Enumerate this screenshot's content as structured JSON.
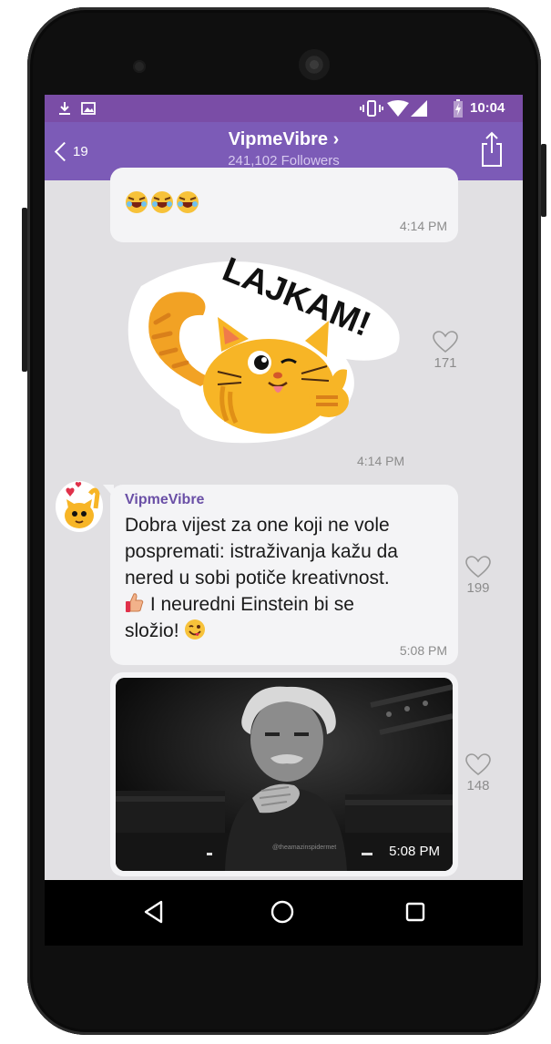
{
  "status_bar": {
    "download_icon": "download-icon",
    "image_icon": "image-icon",
    "time": "10:04"
  },
  "header": {
    "back_count": "19",
    "title": "VipmeVibre ›",
    "subtitle": "241,102 Followers"
  },
  "messages": [
    {
      "type": "emoji-text",
      "time": "4:14 PM"
    },
    {
      "type": "sticker",
      "sticker_text": "LAJKAM!",
      "likes": "171",
      "time": "4:14 PM"
    },
    {
      "type": "text",
      "sender": "VipmeVibre",
      "text_line_1": "Dobra vijest za one koji ne vole",
      "text_line_2": "pospremati: istraživanja kažu da",
      "text_line_3": "nered u sobi potiče kreativnost.",
      "text_line_4": " I neuredni Einstein bi se",
      "text_line_5": "složio! ",
      "likes": "199",
      "time": "5:08 PM"
    },
    {
      "type": "video",
      "watermark": "@theamazinspidermet",
      "likes": "148",
      "time": "5:08 PM"
    }
  ],
  "colors": {
    "status_bar": "#7a4da6",
    "app_bar": "#7c5bb7",
    "chat_bg": "#e1e0e3",
    "sender_name": "#6a4fa6"
  }
}
